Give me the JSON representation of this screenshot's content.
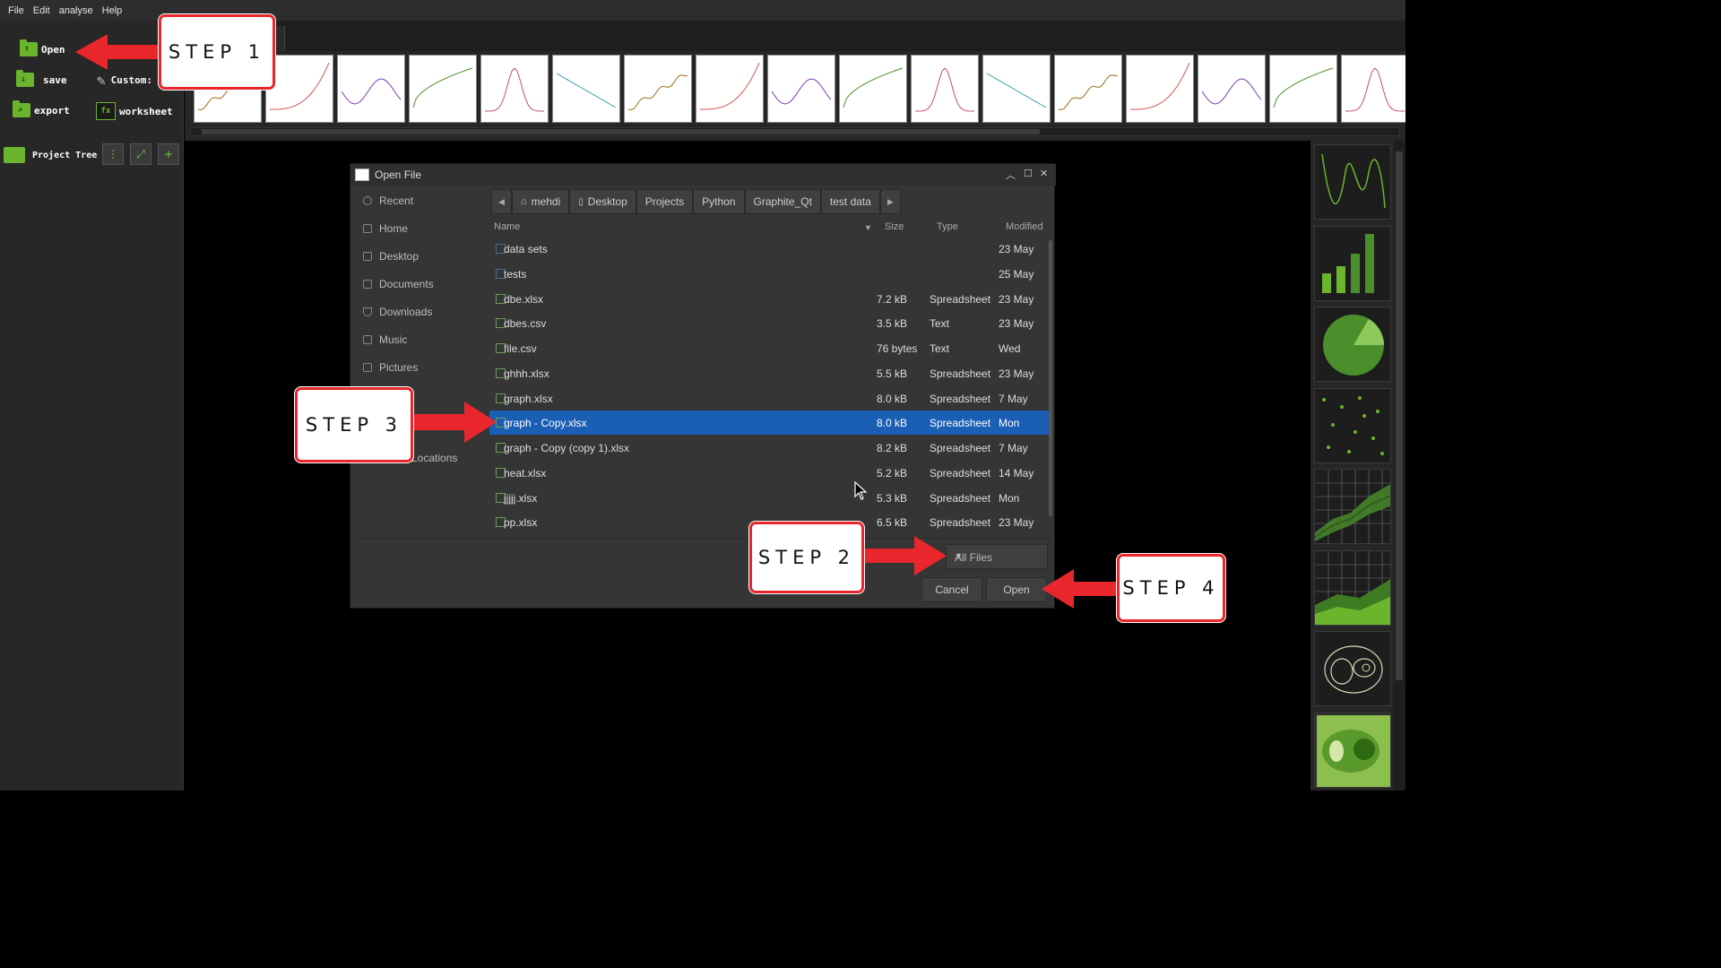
{
  "menu": [
    "File",
    "Edit",
    "analyse",
    "Help"
  ],
  "toolbar": {
    "open_label": "Open",
    "save_label": "save",
    "export_label": "export",
    "custom_label": "Custom:",
    "worksheet_label": "worksheet"
  },
  "project_tree": {
    "label": "Project Tree"
  },
  "dialog": {
    "title": "Open File",
    "places": [
      "Recent",
      "Home",
      "Desktop",
      "Documents",
      "Downloads",
      "Music",
      "Pictures"
    ],
    "other_locations": "Locations",
    "breadcrumbs": [
      "mehdi",
      "Desktop",
      "Projects",
      "Python",
      "Graphite_Qt",
      "test data"
    ],
    "columns": {
      "name": "Name",
      "size": "Size",
      "type": "Type",
      "modified": "Modified"
    },
    "files": [
      {
        "name": "data sets",
        "size": "",
        "type": "",
        "modified": "23  May",
        "is_dir": true
      },
      {
        "name": "tests",
        "size": "",
        "type": "",
        "modified": "25  May",
        "is_dir": true
      },
      {
        "name": "dbe.xlsx",
        "size": "7.2  kB",
        "type": "Spreadsheet",
        "modified": "23  May",
        "is_dir": false
      },
      {
        "name": "dbes.csv",
        "size": "3.5  kB",
        "type": "Text",
        "modified": "23  May",
        "is_dir": false
      },
      {
        "name": "file.csv",
        "size": "76  bytes",
        "type": "Text",
        "modified": "Wed",
        "is_dir": false
      },
      {
        "name": "ghhh.xlsx",
        "size": "5.5  kB",
        "type": "Spreadsheet",
        "modified": "23  May",
        "is_dir": false
      },
      {
        "name": "graph.xlsx",
        "size": "8.0  kB",
        "type": "Spreadsheet",
        "modified": "7  May",
        "is_dir": false
      },
      {
        "name": "graph  -  Copy.xlsx",
        "size": "8.0  kB",
        "type": "Spreadsheet",
        "modified": "Mon",
        "is_dir": false,
        "selected": true
      },
      {
        "name": "graph  -  Copy (copy  1).xlsx",
        "size": "8.2  kB",
        "type": "Spreadsheet",
        "modified": "7  May",
        "is_dir": false
      },
      {
        "name": "heat.xlsx",
        "size": "5.2  kB",
        "type": "Spreadsheet",
        "modified": "14  May",
        "is_dir": false
      },
      {
        "name": "jjjjj.xlsx",
        "size": "5.3  kB",
        "type": "Spreadsheet",
        "modified": "Mon",
        "is_dir": false
      },
      {
        "name": "pp.xlsx",
        "size": "6.5  kB",
        "type": "Spreadsheet",
        "modified": "23  May",
        "is_dir": false
      }
    ],
    "filter": "All Files",
    "cancel_label": "Cancel",
    "open_label": "Open"
  },
  "callouts": {
    "step1": "STEP 1",
    "step2": "STEP 2",
    "step3": "STEP 3",
    "step4": "STEP 4"
  },
  "colors": {
    "accent_green": "#6bb52d",
    "selection": "#1a5fb4",
    "callout_red": "#e8262b"
  }
}
